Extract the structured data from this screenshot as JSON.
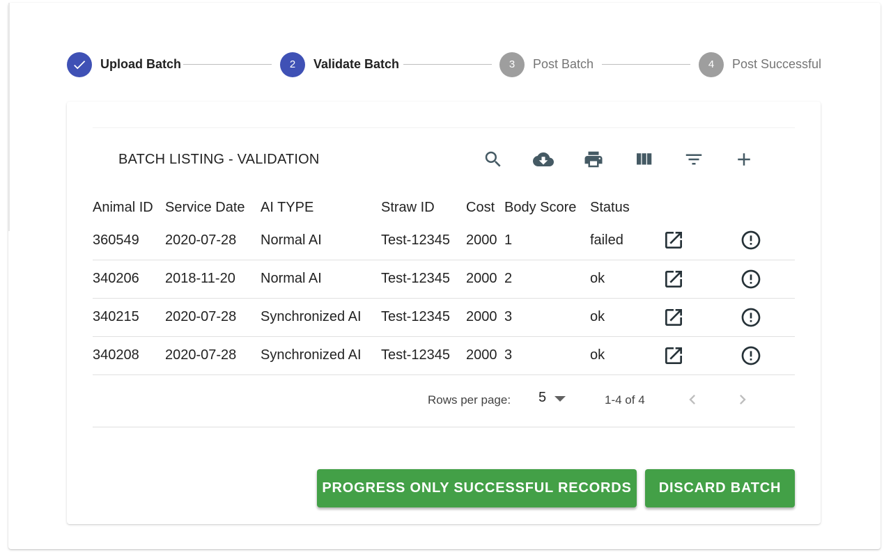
{
  "stepper": {
    "steps": [
      {
        "number": "",
        "label": "Upload Batch",
        "state": "completed",
        "icon": "check-icon"
      },
      {
        "number": "2",
        "label": "Validate Batch",
        "state": "active"
      },
      {
        "number": "3",
        "label": "Post Batch",
        "state": "pending"
      },
      {
        "number": "4",
        "label": "Post Successful",
        "state": "pending"
      }
    ]
  },
  "table": {
    "title": "BATCH LISTING - VALIDATION",
    "toolbar_icons": [
      "search-icon",
      "cloud-download-icon",
      "print-icon",
      "view-columns-icon",
      "filter-list-icon",
      "add-icon"
    ],
    "columns": [
      "Animal ID",
      "Service Date",
      "AI TYPE",
      "Straw ID",
      "Cost",
      "Body Score",
      "Status"
    ],
    "rows": [
      {
        "animal_id": "360549",
        "service_date": "2020-07-28",
        "ai_type": "Normal AI",
        "straw_id": "Test-12345",
        "cost": "2000",
        "body_score": "1",
        "status": "failed"
      },
      {
        "animal_id": "340206",
        "service_date": "2018-11-20",
        "ai_type": "Normal AI",
        "straw_id": "Test-12345",
        "cost": "2000",
        "body_score": "2",
        "status": "ok"
      },
      {
        "animal_id": "340215",
        "service_date": "2020-07-28",
        "ai_type": "Synchronized AI",
        "straw_id": "Test-12345",
        "cost": "2000",
        "body_score": "3",
        "status": "ok"
      },
      {
        "animal_id": "340208",
        "service_date": "2020-07-28",
        "ai_type": "Synchronized AI",
        "straw_id": "Test-12345",
        "cost": "2000",
        "body_score": "3",
        "status": "ok"
      }
    ],
    "row_action_icons": [
      "open-in-new-icon",
      "error-outline-icon"
    ],
    "pagination": {
      "rows_per_page_label": "Rows per page:",
      "rows_per_page_value": "5",
      "range_text": "1-4 of 4"
    }
  },
  "actions": {
    "progress_label": "PROGRESS ONLY SUCCESSFUL RECORDS",
    "discard_label": "DISCARD BATCH"
  },
  "colors": {
    "primary": "#3f51b5",
    "pending_step": "#9e9e9e",
    "success_button": "#43a047",
    "icon": "#455a64"
  }
}
